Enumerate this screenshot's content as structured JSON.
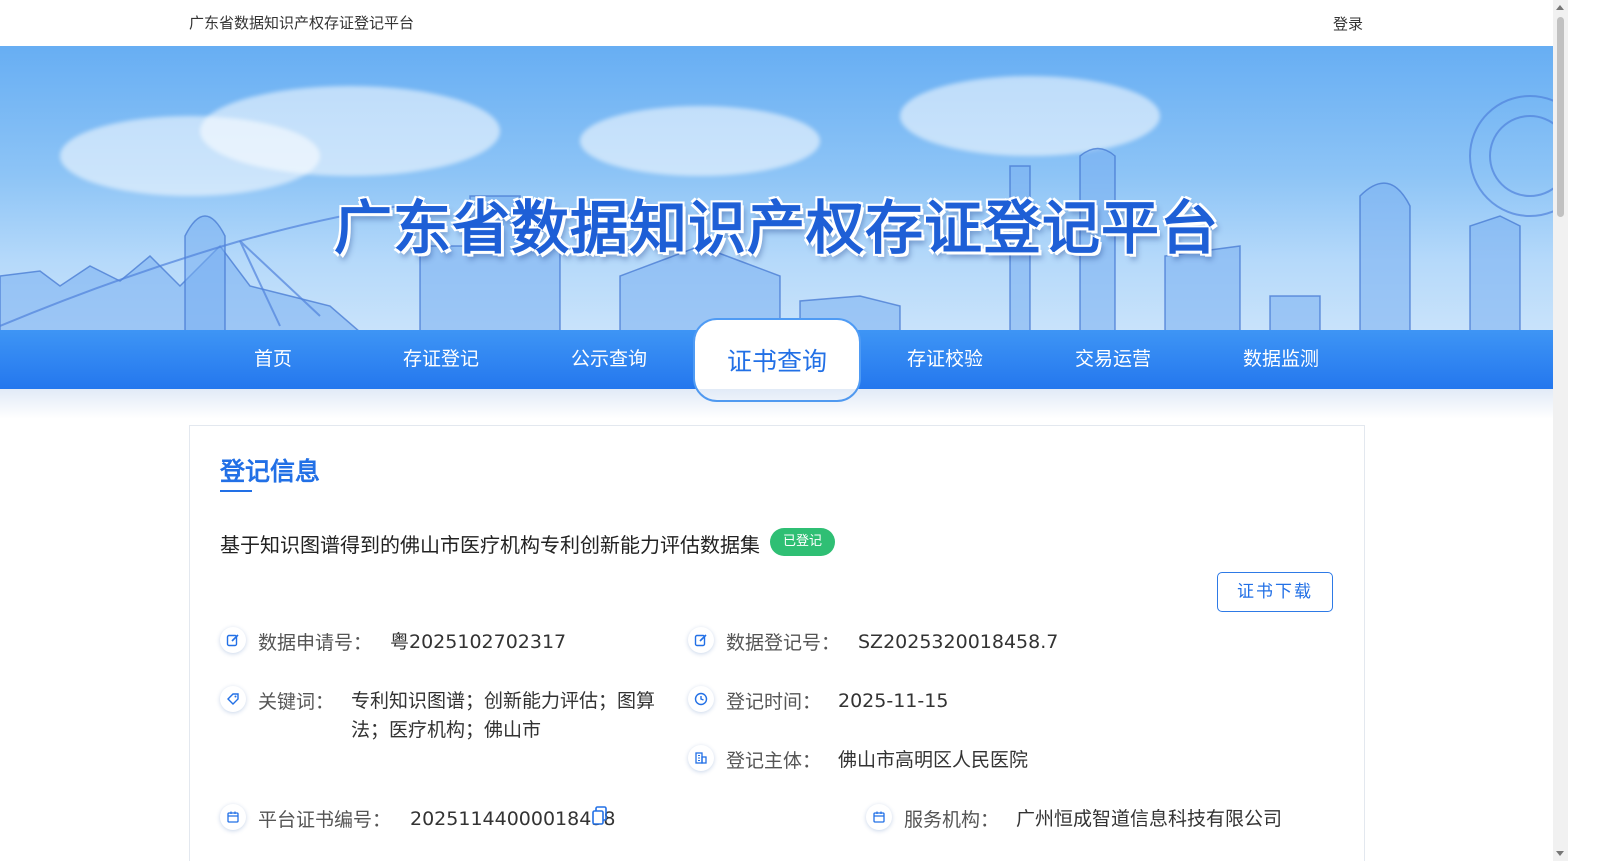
{
  "topbar": {
    "site_title": "广东省数据知识产权存证登记平台",
    "login": "登录"
  },
  "banner": {
    "title": "广东省数据知识产权存证登记平台"
  },
  "nav": {
    "items": [
      {
        "label": "首页"
      },
      {
        "label": "存证登记"
      },
      {
        "label": "公示查询"
      },
      {
        "label": "证书查询"
      },
      {
        "label": "存证校验"
      },
      {
        "label": "交易运营"
      },
      {
        "label": "数据监测"
      }
    ],
    "active": "证书查询"
  },
  "record": {
    "section_title": "登记信息",
    "dataset_title": "基于知识图谱得到的佛山市医疗机构专利创新能力评估数据集",
    "status": "已登记",
    "download_label": "证书下载",
    "application_no_label": "数据申请号：",
    "application_no": "粤2025102702317",
    "registration_no_label": "数据登记号：",
    "registration_no": "SZ2025320018458.7",
    "keywords_label": "关键词：",
    "keywords": "专利知识图谱；创新能力评估；图算法；医疗机构；佛山市",
    "reg_time_label": "登记时间：",
    "reg_time": "2025-11-15",
    "subject_label": "登记主体：",
    "subject": "佛山市高明区人民医院",
    "cert_no_label": "平台证书编号：",
    "cert_no": "20251144000018458",
    "service_label": "服务机构：",
    "service": "广州恒成智道信息科技有限公司"
  },
  "colors": {
    "brand": "#2270e6",
    "badge": "#2fbf74",
    "nav": "#2a7cef"
  }
}
